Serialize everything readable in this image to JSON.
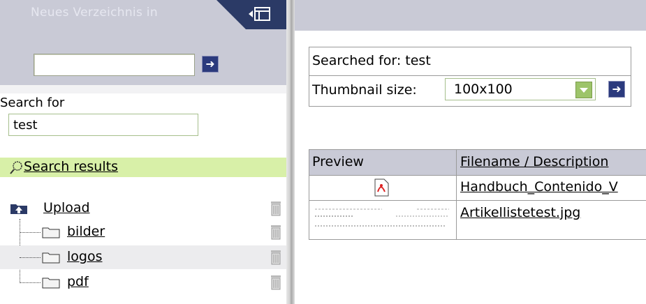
{
  "sidebar": {
    "header_title": "Neues Verzeichnis in",
    "directory_input_value": "",
    "search_label": "Search for",
    "search_value": "test",
    "search_results_label": "Search results",
    "tree": [
      {
        "label": "Upload",
        "level": 0,
        "icon": "upload-folder-icon"
      },
      {
        "label": "bilder",
        "level": 1,
        "icon": "folder-icon"
      },
      {
        "label": "logos",
        "level": 1,
        "icon": "folder-icon"
      },
      {
        "label": "pdf",
        "level": 1,
        "icon": "folder-icon"
      }
    ]
  },
  "main": {
    "searched_for": "Searched for: test",
    "thumbnail_label": "Thumbnail size:",
    "thumbnail_value": "100x100",
    "table": {
      "headers": [
        "Preview",
        "Filename / Description"
      ],
      "rows": [
        {
          "preview": "pdf-icon",
          "filename": "Handbuch_Contenido_V"
        },
        {
          "preview": "image-thumbnail",
          "filename": "Artikellistetest.jpg"
        }
      ]
    }
  },
  "colors": {
    "header_band": "#c9cad6",
    "navy": "#2b3a66",
    "search_highlight": "#d8f0a8",
    "input_border": "#a6bf8c"
  }
}
